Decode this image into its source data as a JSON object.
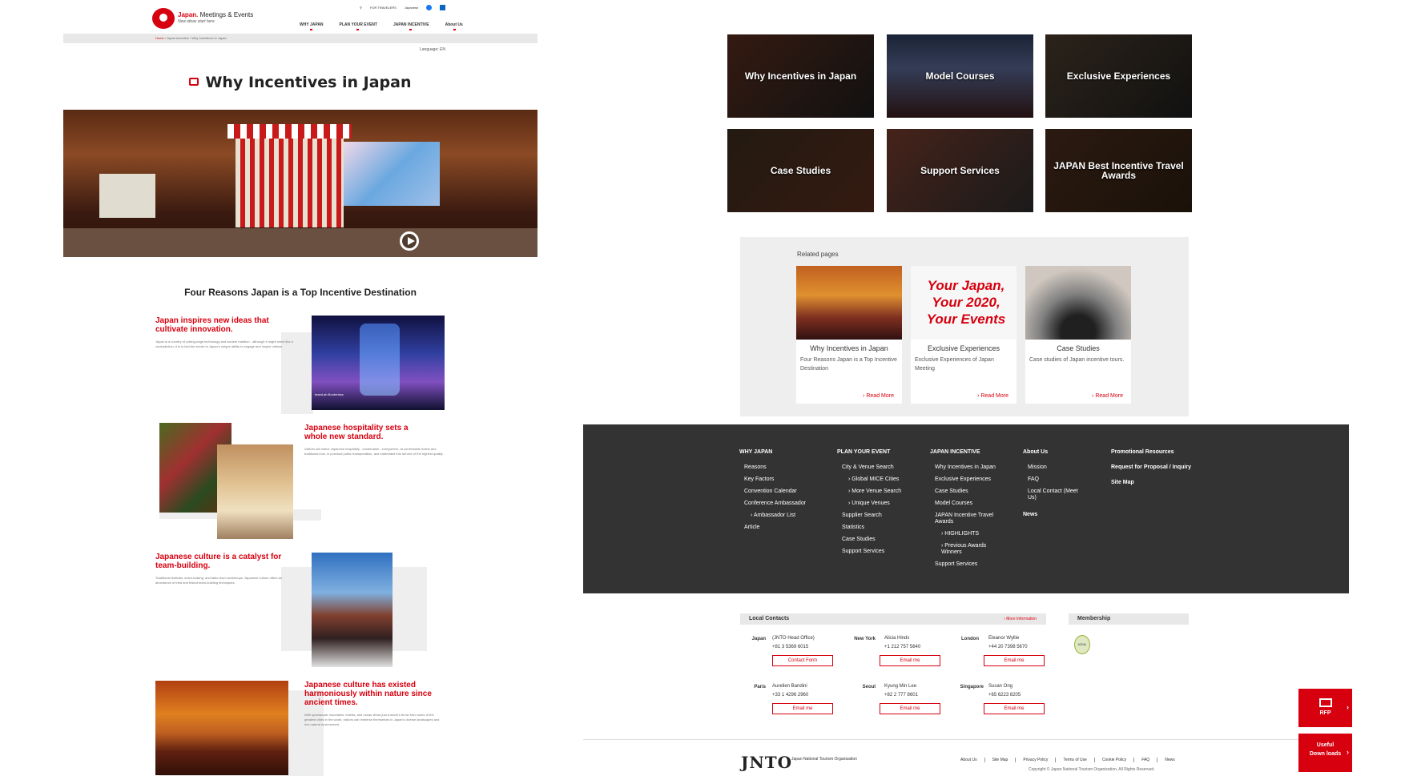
{
  "header": {
    "logo_brand": "Japan.",
    "logo_name": "Meetings & Events",
    "logo_tagline": "New ideas start here",
    "for_travelers": "FOR TRAVELERS",
    "japanese": "Japanese",
    "nav": [
      "WHY JAPAN",
      "PLAN YOUR EVENT",
      "JAPAN INCENTIVE",
      "About Us"
    ]
  },
  "breadcrumb": [
    "Home",
    "Japan Incentive",
    "Why Incentives in Japan"
  ],
  "language": "Language: EN",
  "page_title": "Why Incentives in Japan",
  "reasons_title": "Four Reasons Japan is a Top Incentive Destination",
  "reasons": [
    {
      "heading": "Japan inspires new ideas that cultivate innovation.",
      "body": "Japan is a country of cutting-edge technology and ancient tradition - although it might seem like a contradiction, it is in fact the secret to Japan's unique ability to engage and inspire visitors."
    },
    {
      "heading": "Japanese hospitality sets a whole new standard.",
      "body": "Visitors will notice Japanese hospitality - omotenashi - everywhere, at comfortable hotels and traditional inns, in punctual public transportation, and embedded into service of the highest quality."
    },
    {
      "heading": "Japanese culture is a catalyst for team-building.",
      "body": "Traditional festivals, sushi-making, and taiko drum workshops: Japanese culture offers an abundance of tried and tested team-building techniques."
    },
    {
      "heading": "Japanese culture has existed harmoniously within nature since ancient times.",
      "body": "With spectacular mountains, forests, and ocean views just a stone's throw from some of the greatest cities in the world, visitors can immerse themselves in Japan's diverse landscapes and rich natural environment."
    }
  ],
  "image_caption": "teamLab Borderless",
  "tiles": [
    "Why Incentives in Japan",
    "Model Courses",
    "Exclusive Experiences",
    "Case Studies",
    "Support Services",
    "JAPAN Best Incentive Travel Awards"
  ],
  "related": {
    "title": "Related pages",
    "promo_text": "Your Japan, Your 2020, Your Events",
    "read_more": "Read More",
    "cards": [
      {
        "title": "Why Incentives in Japan",
        "desc": "Four Reasons Japan is a Top Incentive Destination"
      },
      {
        "title": "Exclusive Experiences",
        "desc": "Exclusive Experiences of Japan Meeting"
      },
      {
        "title": "Case Studies",
        "desc": "Case studies of Japan incentive tours."
      }
    ]
  },
  "footer": {
    "why_japan": {
      "heading": "WHY JAPAN",
      "items": [
        "Reasons",
        "Key Factors",
        "Convention Calendar",
        "Conference Ambassador",
        "Ambassador List",
        "Article"
      ]
    },
    "plan": {
      "heading": "PLAN YOUR EVENT",
      "items": [
        "City & Venue Search",
        "Global MICE Cities",
        "More Venue Search",
        "Unique Venues",
        "Supplier Search",
        "Statistics",
        "Case Studies",
        "Support Services"
      ]
    },
    "incentive": {
      "heading": "JAPAN INCENTIVE",
      "items": [
        "Why Incentives in Japan",
        "Exclusive Experiences",
        "Case Studies",
        "Model Courses",
        "JAPAN Incentive Travel Awards",
        "HIGHLIGHTS",
        "Previous Awards Winners",
        "Support Services"
      ]
    },
    "about": {
      "heading": "About Us",
      "items": [
        "Mission",
        "FAQ",
        "Local Contact (Meet Us)"
      ],
      "news": "News"
    },
    "promo": {
      "heading": "Promotional Resources",
      "rfp": "Request for Proposal / Inquiry",
      "sitemap": "Site Map"
    }
  },
  "local_contacts": {
    "title": "Local Contacts",
    "more": "More Information",
    "membership": "Membership",
    "membership_badge": "ICCA",
    "contact_form": "Contact Form",
    "email_me": "Email me",
    "offices": [
      {
        "city": "Japan",
        "name": "(JNTO Head Office)",
        "phone": "+81 3 5369 6015"
      },
      {
        "city": "New York",
        "name": "Alicia Hinds",
        "phone": "+1 212 757 5640"
      },
      {
        "city": "London",
        "name": "Eleanor Wyllie",
        "phone": "+44 20 7398 5670"
      },
      {
        "city": "Paris",
        "name": "Aurelien Bandini",
        "phone": "+33 1 4296 2960"
      },
      {
        "city": "Seoul",
        "name": "Kyung Min Lee",
        "phone": "+82 2 777 8601"
      },
      {
        "city": "Singapore",
        "name": "Susan Ong",
        "phone": "+65 6223 8205"
      }
    ]
  },
  "bottom": {
    "logo": "JNTO",
    "org": "Japan National Tourism Organization",
    "links": [
      "About Us",
      "Site Map",
      "Privacy Policy",
      "Terms of Use",
      "Cookie Policy",
      "FAQ",
      "News"
    ],
    "copyright": "Copyright © Japan National Tourism Organization. All Rights Reserved."
  },
  "side_buttons": {
    "rfp": "RFP",
    "downloads": "Useful Down loads"
  },
  "colors": {
    "brand_red": "#d7000f",
    "footer_bg": "#333333"
  }
}
